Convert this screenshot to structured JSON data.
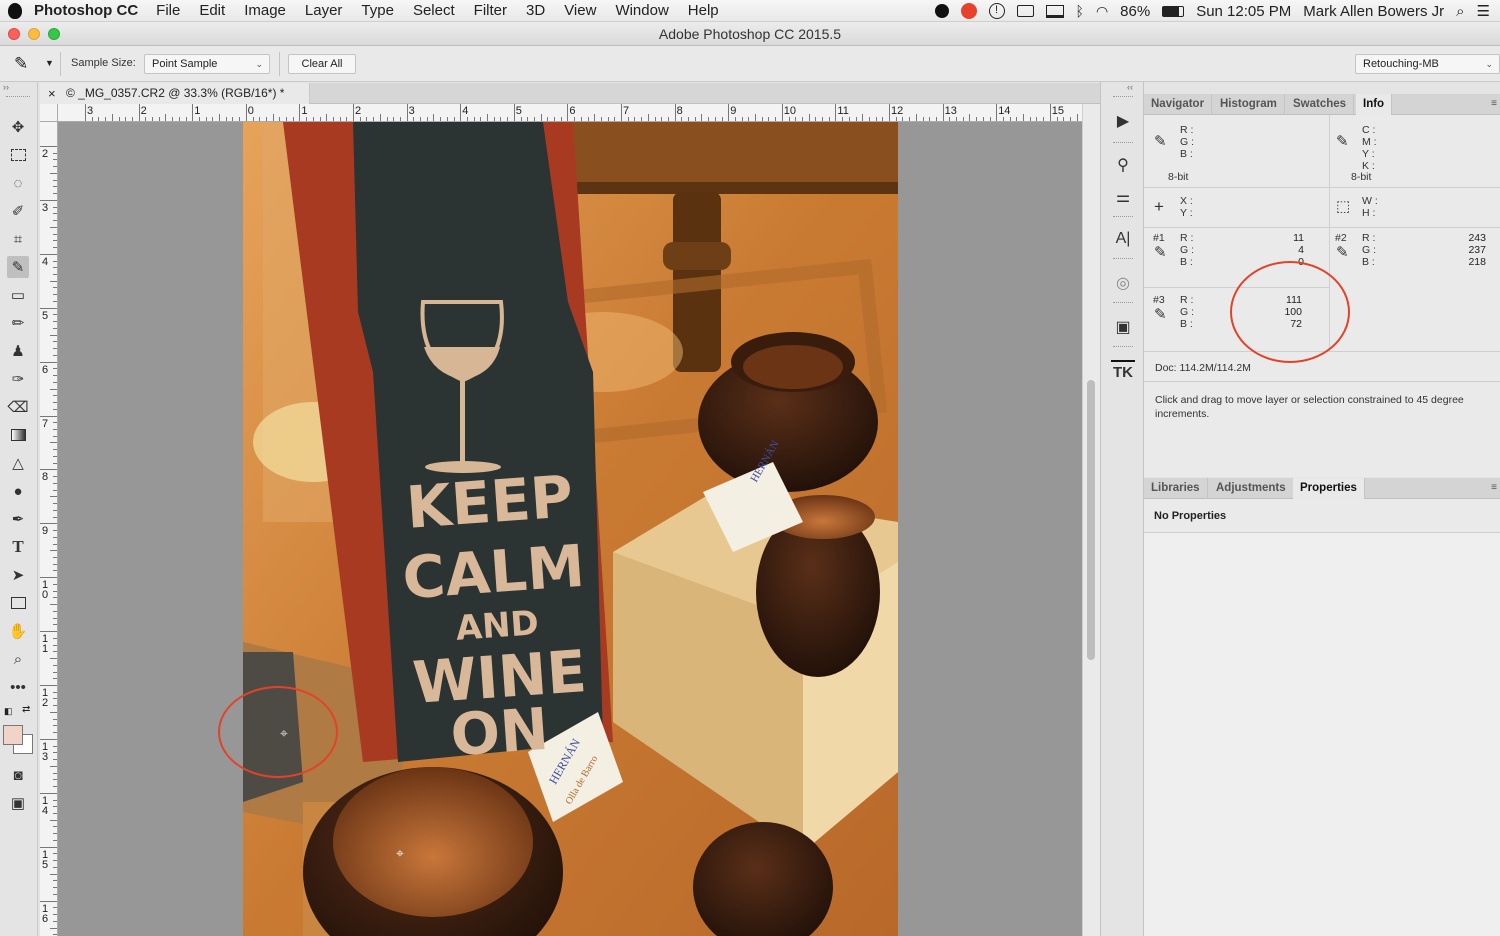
{
  "menubar": {
    "app_name": "Photoshop CC",
    "items": [
      "File",
      "Edit",
      "Image",
      "Layer",
      "Type",
      "Select",
      "Filter",
      "3D",
      "View",
      "Window",
      "Help"
    ],
    "battery": "86%",
    "clock": "Sun 12:05 PM",
    "user": "Mark Allen Bowers Jr"
  },
  "window": {
    "title": "Adobe Photoshop CC 2015.5"
  },
  "options": {
    "sample_size_label": "Sample Size:",
    "sample_size_value": "Point Sample",
    "clear_all": "Clear All",
    "workspace": "Retouching-MB"
  },
  "document": {
    "tab_close": "×",
    "tab_title": "© _MG_0357.CR2 @ 33.3% (RGB/16*) *"
  },
  "rulers": {
    "horizontal": [
      "3",
      "2",
      "1",
      "0",
      "1",
      "2",
      "3",
      "4",
      "5",
      "6",
      "7",
      "8",
      "9",
      "10",
      "11",
      "12",
      "13",
      "14",
      "15"
    ],
    "vertical": [
      "2",
      "3",
      "4",
      "5",
      "6",
      "7",
      "8",
      "9",
      "10",
      "11",
      "12",
      "13",
      "14",
      "15",
      "16"
    ]
  },
  "photo": {
    "sign_lines": [
      "KEEP",
      "CALM",
      "AND",
      "WINE",
      "ON"
    ],
    "tag_brand": "HERNÁN",
    "tag_sub": "Olla de Barro"
  },
  "panels": {
    "top_tabs": [
      "Navigator",
      "Histogram",
      "Swatches",
      "Info"
    ],
    "bottom_tabs": [
      "Libraries",
      "Adjustments",
      "Properties"
    ],
    "no_properties": "No Properties"
  },
  "info": {
    "rgb_labels": [
      "R :",
      "G :",
      "B :"
    ],
    "cmyk_labels": [
      "C :",
      "M :",
      "Y :",
      "K :"
    ],
    "bit_left": "8-bit",
    "bit_right": "8-bit",
    "xy_labels": [
      "X :",
      "Y :"
    ],
    "wh_labels": [
      "W :",
      "H :"
    ],
    "sampler1": {
      "id": "#1",
      "r": "11",
      "g": "4",
      "b": "0"
    },
    "sampler2": {
      "id": "#2",
      "r": "243",
      "g": "237",
      "b": "218"
    },
    "sampler3": {
      "id": "#3",
      "r": "111",
      "g": "100",
      "b": "72"
    },
    "doc": "Doc: 114.2M/114.2M",
    "hint": "Click and drag to move layer or selection constrained to 45 degree increments."
  },
  "colors": {
    "annotation": "#e24328",
    "foreground_swatch": "#f2d3c8",
    "background_swatch": "#ffffff"
  }
}
